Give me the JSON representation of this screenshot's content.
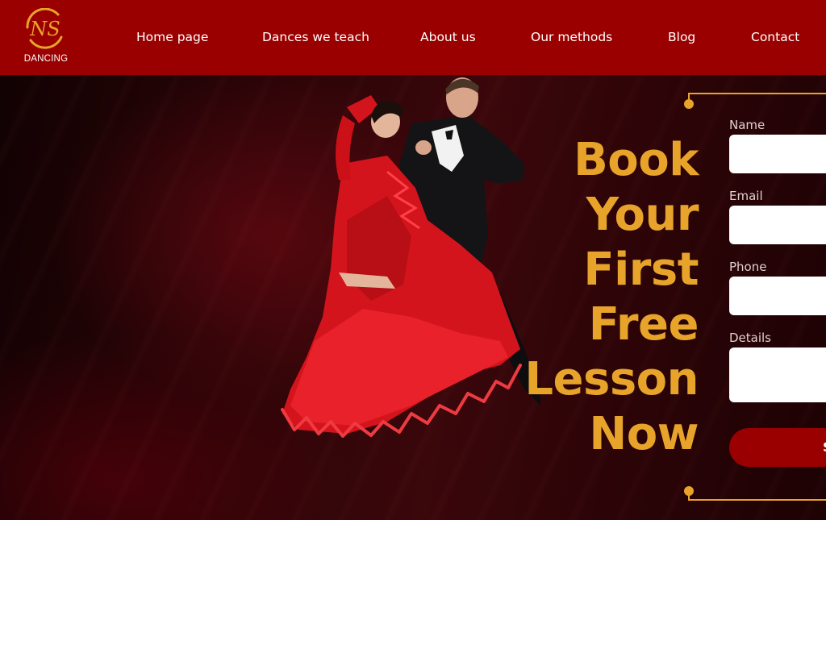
{
  "brand": {
    "logo_monogram": "NS",
    "logo_word": "DANCING",
    "colors": {
      "primary": "#9b0000",
      "accent": "#e8a42a",
      "hero_dark": "#2a0407"
    }
  },
  "nav": {
    "items": [
      {
        "label": "Home page"
      },
      {
        "label": "Dances we teach"
      },
      {
        "label": "About us"
      },
      {
        "label": "Our methods"
      },
      {
        "label": "Blog"
      },
      {
        "label": "Contact"
      }
    ]
  },
  "hero": {
    "image": "ballroom-dancers-photo",
    "headline": [
      "Book",
      "Your",
      "First",
      "Free",
      "Lesson",
      "Now"
    ]
  },
  "form": {
    "name_label": "Name",
    "email_label": "Email",
    "phone_label": "Phone",
    "details_label": "Details",
    "name_value": "",
    "email_value": "",
    "phone_value": "",
    "details_value": "",
    "submit_label": "Submit"
  }
}
